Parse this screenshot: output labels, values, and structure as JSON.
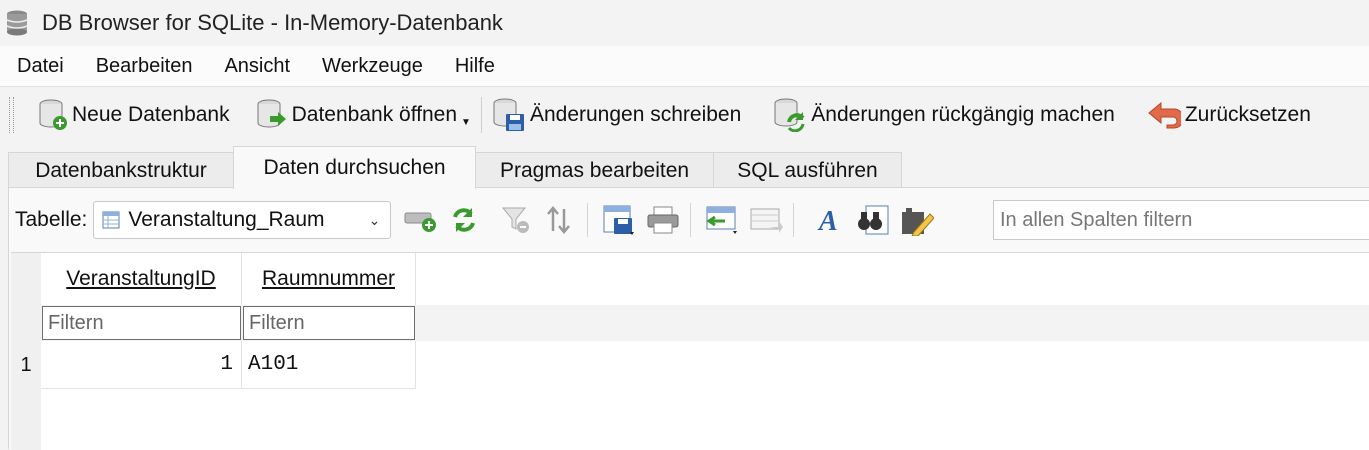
{
  "window": {
    "title": "DB Browser for SQLite - In-Memory-Datenbank"
  },
  "menu": [
    "Datei",
    "Bearbeiten",
    "Ansicht",
    "Werkzeuge",
    "Hilfe"
  ],
  "toolbar": {
    "new_db": "Neue Datenbank",
    "open_db": "Datenbank öffnen",
    "write_changes": "Änderungen schreiben",
    "revert_changes": "Änderungen rückgängig machen",
    "reset": "Zurücksetzen"
  },
  "tabs": [
    "Datenbankstruktur",
    "Daten durchsuchen",
    "Pragmas bearbeiten",
    "SQL ausführen"
  ],
  "browse": {
    "table_label": "Tabelle:",
    "selected_table": "Veranstaltung_Raum",
    "global_filter_placeholder": "In allen Spalten filtern",
    "columns": [
      "VeranstaltungID",
      "Raumnummer"
    ],
    "filter_placeholder": "Filtern",
    "rows": [
      {
        "num": "1",
        "cells": [
          "1",
          "A101"
        ]
      }
    ]
  },
  "colors": {
    "accent_green": "#3a9a2e",
    "accent_blue": "#2d5fa8",
    "reset_red": "#e06a4a"
  }
}
